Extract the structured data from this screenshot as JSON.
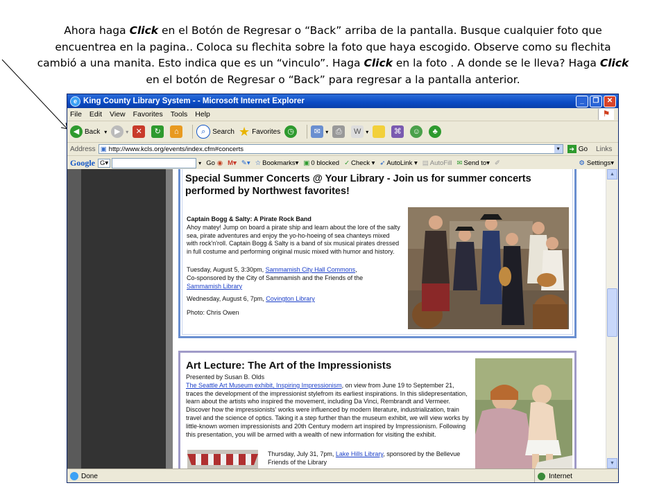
{
  "instruction": {
    "part1": "Ahora haga ",
    "click1": "Click",
    "part2": " en el Botón de Regresar o “Back” arriba de la pantalla. Busque cualquier foto que encuentrea en la pagina.. Coloca su flechita sobre la foto que haya escogido.  Observe como su flechita cambió a una manita. Esto indica que es un “vinculo”. Haga ",
    "click2": "Click",
    "part3": " en  la foto .  A donde se le lleva?  Haga ",
    "click3": "Click",
    "part4": " en el botón de Regresar o “Back” para regresar a la pantalla anterior."
  },
  "browser": {
    "window_title": "King County Library System - - Microsoft Internet Explorer",
    "menu": [
      "File",
      "Edit",
      "View",
      "Favorites",
      "Tools",
      "Help"
    ],
    "toolbar": {
      "back": "Back",
      "search": "Search",
      "favorites": "Favorites"
    },
    "address_label": "Address",
    "address_value": "http://www.kcls.org/events/index.cfm#concerts",
    "go_label": "Go",
    "links_label": "Links",
    "googlebar": {
      "logo": "Google",
      "go": "Go",
      "bookmarks": "Bookmarks▾",
      "blocked": "0 blocked",
      "check": "Check ▾",
      "autolink": "AutoLink ▾",
      "autofill": "AutoFill",
      "sendto": "Send to▾",
      "settings": "Settings▾"
    },
    "status_left": "Done",
    "status_zone": "Internet"
  },
  "event1": {
    "heading": "Special Summer Concerts @ Your Library - Join us for summer concerts performed by Northwest favorites!",
    "name": "Captain Bogg & Salty: A Pirate Rock Band",
    "description": "Ahoy matey! Jump on board a pirate ship and learn about the lore of the salty sea, pirate adventures and enjoy the yo-ho-hoeing of sea chanteys mixed with rock'n'roll.  Captain Bogg & Salty is a band of six musical pirates dressed in full costume and performing original music mixed with humor and history.",
    "date1": "Tuesday, August 5, 3:30pm, ",
    "link1": "Sammamish City Hall Commons",
    "cosponsor_prefix": "Co-sponsored by the City of Sammamish and the Friends of the ",
    "link2": "Sammamish Library",
    "date2": "Wednesday, August 6, 7pm, ",
    "link3": "Covington Library",
    "photo_credit": "Photo: Chris Owen"
  },
  "event2": {
    "heading": "Art Lecture: The Art of the Impressionists",
    "presenter": "Presented by Susan B. Olds",
    "link1": "The Seattle Art Museum exhibit, Inspiring Impressionism",
    "description": ", on view from June 19 to September 21, traces the development of the impressionist stylefrom its earliest inspirations. In this slidepresentation, learn about the artists who inspired the movement, including Da Vinci, Rembrandt and Vermeer. Discover how the impressionists' works were influenced by modern literature, industrialization, train travel and the science of optics. Taking it a step further than the museum exhibit, we will view works by little-known women impressionists and 20th Century modern art inspired by Impressionism. Following this presentation, you will be armed with a wealth of new information for visiting the exhibit.",
    "date": "Thursday, July 31, 7pm, ",
    "link2": "Lake Hills Library",
    "sponsor": ", sponsored by the Bellevue Friends of the Library"
  }
}
